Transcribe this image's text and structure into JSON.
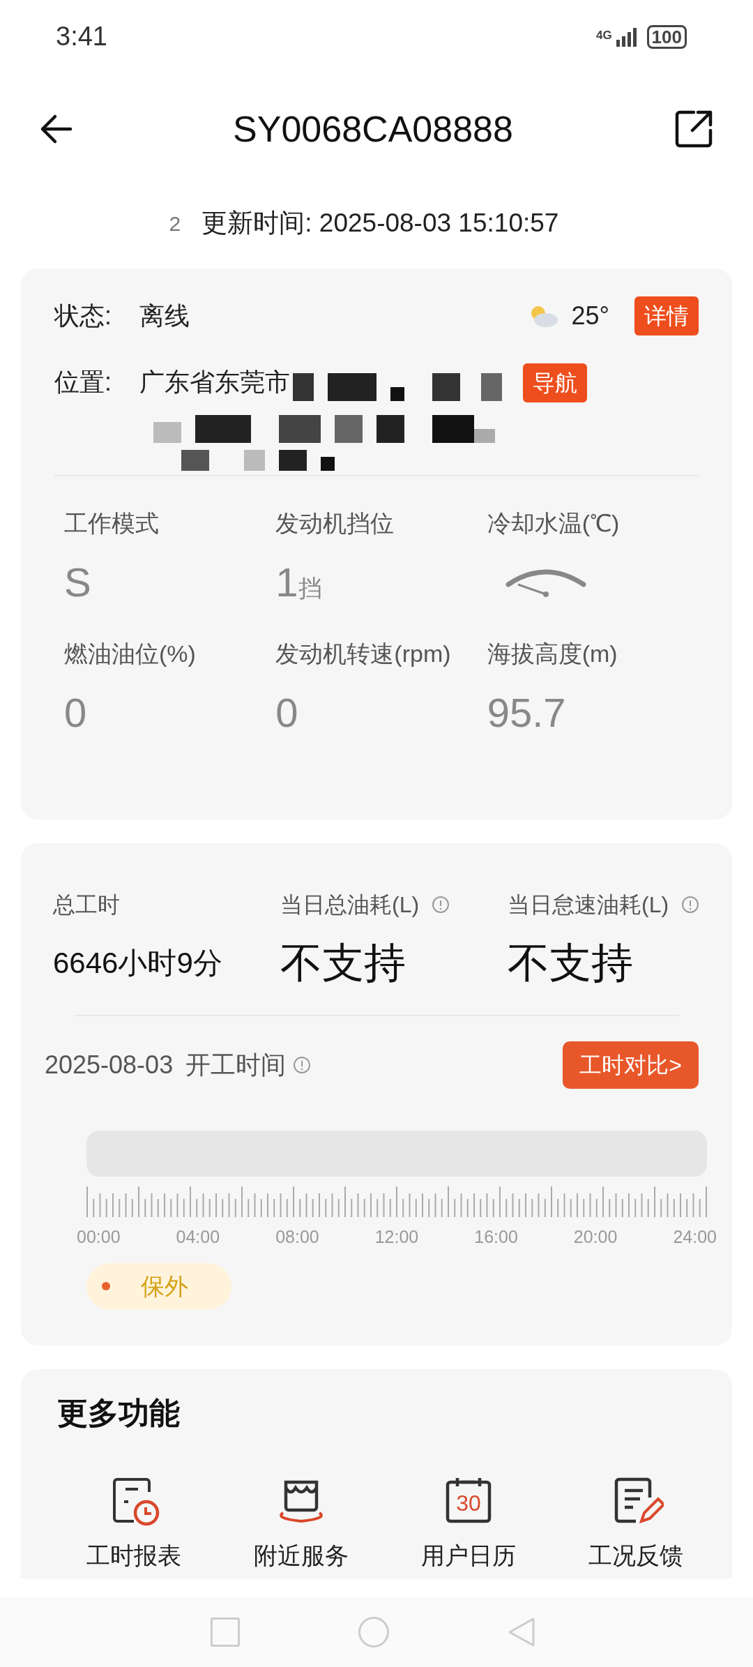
{
  "status_bar": {
    "time": "3:41",
    "network": "4G",
    "battery": "100"
  },
  "header": {
    "title": "SY0068CA08888"
  },
  "update": {
    "refresh_count": "2",
    "text": "更新时间: 2025-08-03 15:10:57"
  },
  "device": {
    "status_label": "状态:",
    "status_value": "离线",
    "temperature": "25°",
    "details_button": "详情",
    "location_label": "位置:",
    "location_text": "广东省东莞市",
    "navigate_button": "导航"
  },
  "metrics": [
    {
      "kind": "text",
      "label": "工作模式",
      "value": "S"
    },
    {
      "kind": "text",
      "label": "发动机挡位",
      "value": "1",
      "unit": "挡"
    },
    {
      "kind": "gauge",
      "label": "冷却水温(℃)"
    },
    {
      "kind": "text",
      "label": "燃油油位(%)",
      "value": "0"
    },
    {
      "kind": "text",
      "label": "发动机转速(rpm)",
      "value": "0"
    },
    {
      "kind": "text",
      "label": "海拔高度(m)",
      "value": "95.7"
    }
  ],
  "work": {
    "summary": [
      {
        "label": "总工时",
        "value": "6646小时9分",
        "info": false
      },
      {
        "label": "当日总油耗(L)",
        "value": "不支持",
        "info": true
      },
      {
        "label": "当日怠速油耗(L)",
        "value": "不支持",
        "info": true
      }
    ],
    "date": "2025-08-03",
    "start_label": "开工时间",
    "compare_button": "工时对比>",
    "ticks": [
      "00:00",
      "04:00",
      "08:00",
      "12:00",
      "16:00",
      "20:00",
      "24:00"
    ],
    "legend": [
      {
        "label": "保外",
        "color": "#e8622c"
      }
    ]
  },
  "more": {
    "title": "更多功能",
    "items": [
      {
        "kind": "report",
        "label": "工时报表"
      },
      {
        "kind": "service",
        "label": "附近服务"
      },
      {
        "kind": "calendar",
        "label": "用户日历",
        "icon_text": "30"
      },
      {
        "kind": "feedback",
        "label": "工况反馈"
      }
    ]
  }
}
